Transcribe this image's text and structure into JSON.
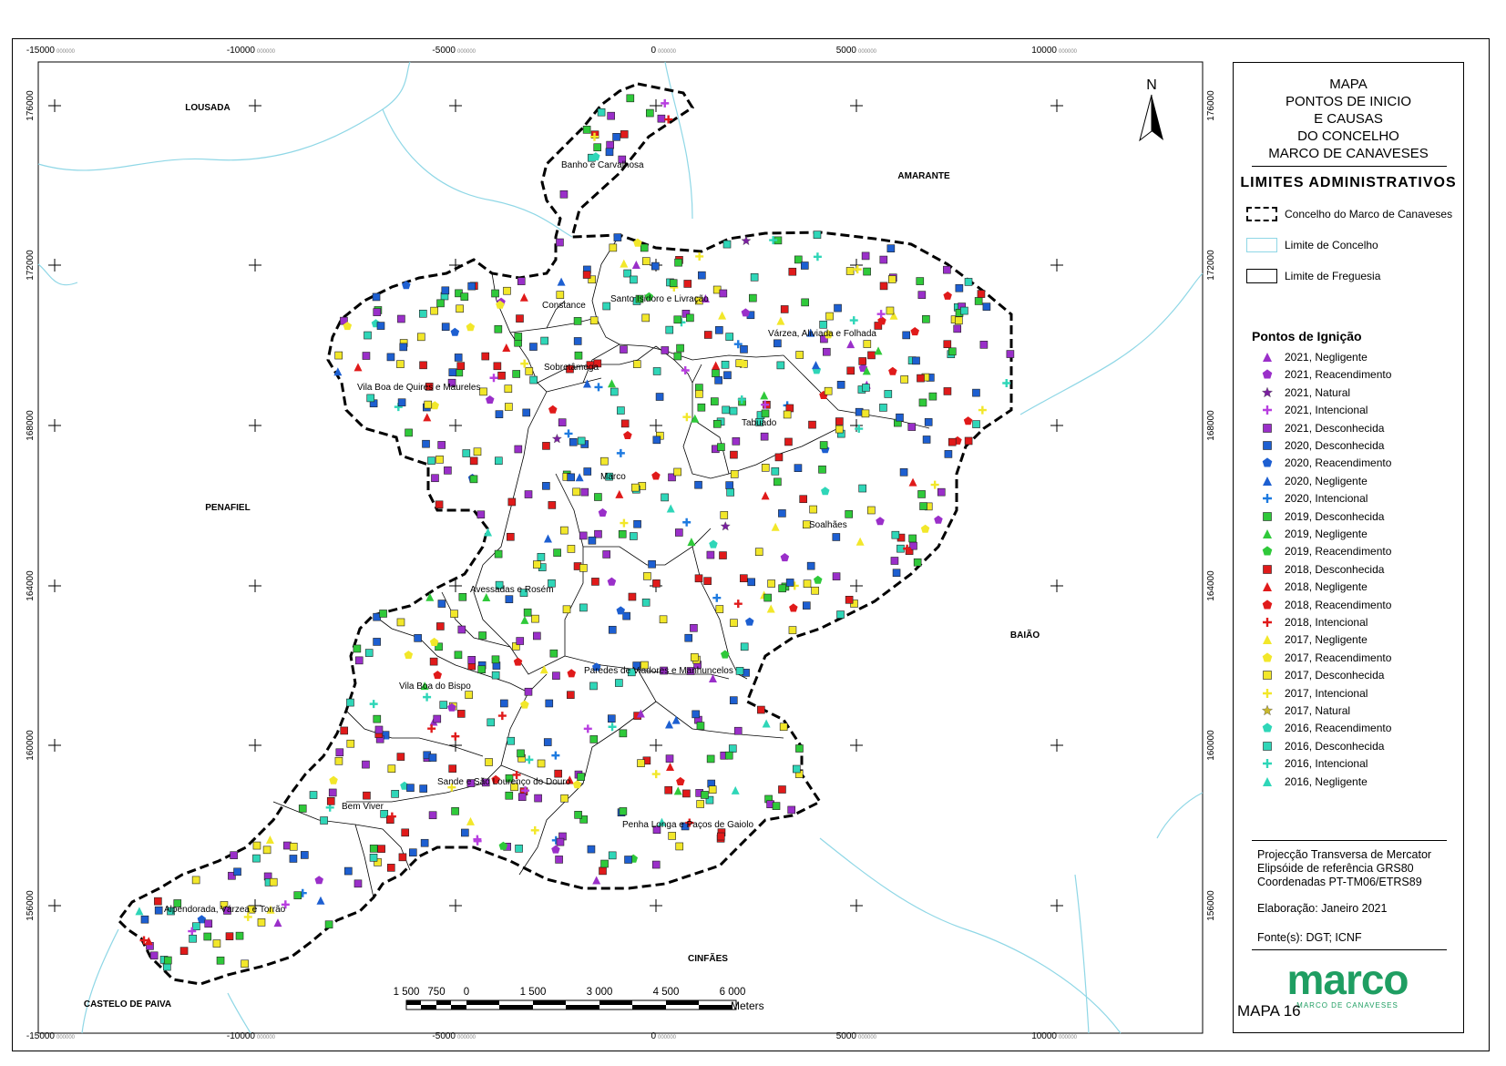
{
  "map": {
    "axis_labels_x": [
      "-15000",
      "-10000",
      "-5000",
      "0",
      "5000",
      "10000"
    ],
    "axis_labels_y": [
      "176000",
      "172000",
      "168000",
      "164000",
      "160000",
      "156000"
    ],
    "grid_minor": "000000",
    "neighbors": [
      {
        "name": "LOUSADA"
      },
      {
        "name": "AMARANTE"
      },
      {
        "name": "PENAFIEL"
      },
      {
        "name": "BAIÃO"
      },
      {
        "name": "CINFÃES"
      },
      {
        "name": "CASTELO DE PAIVA"
      }
    ],
    "parishes": [
      "Banho e Carvalhosa",
      "Santo Isidoro e Livração",
      "Constance",
      "Várzea, Aliviada e Folhada",
      "Sobretâmega",
      "Vila Boa de Quires e Maureles",
      "Tabuado",
      "Marco",
      "Soalhães",
      "Avessadas e Rosém",
      "Paredes de Viadores e Manhuncelos",
      "Vila Boa do Bispo",
      "Sande e São Lourenço do Douro",
      "Bem Viver",
      "Penha Longa e Paços de Gaiolo",
      "Alpendorada, Várzea e Torrão"
    ],
    "north_label": "N",
    "scale": {
      "labels": [
        "1 500",
        "750",
        "0",
        "1 500",
        "3 000",
        "4 500",
        "6 000"
      ],
      "unit": "Meters"
    }
  },
  "legend": {
    "title_lines": [
      "MAPA",
      "PONTOS DE INICIO",
      "E CAUSAS",
      "DO CONCELHO",
      "MARCO DE CANAVESES"
    ],
    "section_title": "LIMITES ADMINISTRATIVOS",
    "boundaries": [
      {
        "label": "Concelho do Marco de Canaveses",
        "style": "dashed"
      },
      {
        "label": "Limite de Concelho",
        "style": "cyan"
      },
      {
        "label": "Limite de Freguesia",
        "style": "solid"
      }
    ],
    "points_title": "Pontos de Ignição",
    "points": [
      {
        "label": "2021, Negligente",
        "shape": "triangle",
        "color": "#9a2fc9"
      },
      {
        "label": "2021, Reacendimento",
        "shape": "pentagon",
        "color": "#9a2fc9"
      },
      {
        "label": "2021, Natural",
        "shape": "star",
        "color": "#7a1fa0"
      },
      {
        "label": "2021, Intencional",
        "shape": "cross",
        "color": "#b83fe0"
      },
      {
        "label": "2021, Desconhecida",
        "shape": "square",
        "color": "#9a2fc9"
      },
      {
        "label": "2020, Desconhecida",
        "shape": "square",
        "color": "#1d5fd1"
      },
      {
        "label": "2020, Reacendimento",
        "shape": "pentagon",
        "color": "#1d5fd1"
      },
      {
        "label": "2020, Negligente",
        "shape": "triangle",
        "color": "#1d5fd1"
      },
      {
        "label": "2020, Intencional",
        "shape": "cross",
        "color": "#1d7ae0"
      },
      {
        "label": "2019, Desconhecida",
        "shape": "square",
        "color": "#2fc93a"
      },
      {
        "label": "2019, Negligente",
        "shape": "triangle",
        "color": "#2fc93a"
      },
      {
        "label": "2019, Reacendimento",
        "shape": "pentagon",
        "color": "#2fc93a"
      },
      {
        "label": "2018, Desconhecida",
        "shape": "square",
        "color": "#e01a1a"
      },
      {
        "label": "2018, Negligente",
        "shape": "triangle",
        "color": "#e01a1a"
      },
      {
        "label": "2018, Reacendimento",
        "shape": "pentagon",
        "color": "#e01a1a"
      },
      {
        "label": "2018, Intencional",
        "shape": "cross",
        "color": "#e01a1a"
      },
      {
        "label": "2017, Negligente",
        "shape": "triangle",
        "color": "#f2e72a"
      },
      {
        "label": "2017, Reacendimento",
        "shape": "pentagon",
        "color": "#f2e72a"
      },
      {
        "label": "2017, Desconhecida",
        "shape": "square",
        "color": "#f2e72a"
      },
      {
        "label": "2017, Intencional",
        "shape": "cross",
        "color": "#f2e72a"
      },
      {
        "label": "2017, Natural",
        "shape": "star",
        "color": "#c9b82a"
      },
      {
        "label": "2016, Reacendimento",
        "shape": "pentagon",
        "color": "#2fd6b8"
      },
      {
        "label": "2016, Desconhecida",
        "shape": "square",
        "color": "#2fd6b8"
      },
      {
        "label": "2016, Intencional",
        "shape": "cross",
        "color": "#2fd6b8"
      },
      {
        "label": "2016, Negligente",
        "shape": "triangle",
        "color": "#2fd6b8"
      }
    ],
    "projection_lines": [
      "Projecção Transversa de Mercator",
      "Elipsóide de referência GRS80",
      "Coordenadas PT-TM06/ETRS89"
    ],
    "elaboration": "Elaboração: Janeiro 2021",
    "sources": "Fonte(s): DGT; ICNF",
    "logo_text": "marco",
    "logo_sub": "MARCO DE CANAVESES",
    "map_number": "MAPA 16"
  }
}
